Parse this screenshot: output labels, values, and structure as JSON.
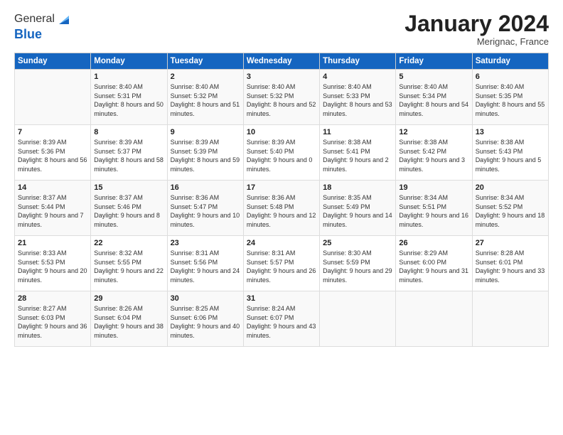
{
  "logo": {
    "general": "General",
    "blue": "Blue"
  },
  "title": "January 2024",
  "subtitle": "Merignac, France",
  "days": [
    "Sunday",
    "Monday",
    "Tuesday",
    "Wednesday",
    "Thursday",
    "Friday",
    "Saturday"
  ],
  "weeks": [
    [
      {
        "day": "",
        "sunrise": "",
        "sunset": "",
        "daylight": ""
      },
      {
        "day": "1",
        "sunrise": "Sunrise: 8:40 AM",
        "sunset": "Sunset: 5:31 PM",
        "daylight": "Daylight: 8 hours and 50 minutes."
      },
      {
        "day": "2",
        "sunrise": "Sunrise: 8:40 AM",
        "sunset": "Sunset: 5:32 PM",
        "daylight": "Daylight: 8 hours and 51 minutes."
      },
      {
        "day": "3",
        "sunrise": "Sunrise: 8:40 AM",
        "sunset": "Sunset: 5:32 PM",
        "daylight": "Daylight: 8 hours and 52 minutes."
      },
      {
        "day": "4",
        "sunrise": "Sunrise: 8:40 AM",
        "sunset": "Sunset: 5:33 PM",
        "daylight": "Daylight: 8 hours and 53 minutes."
      },
      {
        "day": "5",
        "sunrise": "Sunrise: 8:40 AM",
        "sunset": "Sunset: 5:34 PM",
        "daylight": "Daylight: 8 hours and 54 minutes."
      },
      {
        "day": "6",
        "sunrise": "Sunrise: 8:40 AM",
        "sunset": "Sunset: 5:35 PM",
        "daylight": "Daylight: 8 hours and 55 minutes."
      }
    ],
    [
      {
        "day": "7",
        "sunrise": "Sunrise: 8:39 AM",
        "sunset": "Sunset: 5:36 PM",
        "daylight": "Daylight: 8 hours and 56 minutes."
      },
      {
        "day": "8",
        "sunrise": "Sunrise: 8:39 AM",
        "sunset": "Sunset: 5:37 PM",
        "daylight": "Daylight: 8 hours and 58 minutes."
      },
      {
        "day": "9",
        "sunrise": "Sunrise: 8:39 AM",
        "sunset": "Sunset: 5:39 PM",
        "daylight": "Daylight: 8 hours and 59 minutes."
      },
      {
        "day": "10",
        "sunrise": "Sunrise: 8:39 AM",
        "sunset": "Sunset: 5:40 PM",
        "daylight": "Daylight: 9 hours and 0 minutes."
      },
      {
        "day": "11",
        "sunrise": "Sunrise: 8:38 AM",
        "sunset": "Sunset: 5:41 PM",
        "daylight": "Daylight: 9 hours and 2 minutes."
      },
      {
        "day": "12",
        "sunrise": "Sunrise: 8:38 AM",
        "sunset": "Sunset: 5:42 PM",
        "daylight": "Daylight: 9 hours and 3 minutes."
      },
      {
        "day": "13",
        "sunrise": "Sunrise: 8:38 AM",
        "sunset": "Sunset: 5:43 PM",
        "daylight": "Daylight: 9 hours and 5 minutes."
      }
    ],
    [
      {
        "day": "14",
        "sunrise": "Sunrise: 8:37 AM",
        "sunset": "Sunset: 5:44 PM",
        "daylight": "Daylight: 9 hours and 7 minutes."
      },
      {
        "day": "15",
        "sunrise": "Sunrise: 8:37 AM",
        "sunset": "Sunset: 5:46 PM",
        "daylight": "Daylight: 9 hours and 8 minutes."
      },
      {
        "day": "16",
        "sunrise": "Sunrise: 8:36 AM",
        "sunset": "Sunset: 5:47 PM",
        "daylight": "Daylight: 9 hours and 10 minutes."
      },
      {
        "day": "17",
        "sunrise": "Sunrise: 8:36 AM",
        "sunset": "Sunset: 5:48 PM",
        "daylight": "Daylight: 9 hours and 12 minutes."
      },
      {
        "day": "18",
        "sunrise": "Sunrise: 8:35 AM",
        "sunset": "Sunset: 5:49 PM",
        "daylight": "Daylight: 9 hours and 14 minutes."
      },
      {
        "day": "19",
        "sunrise": "Sunrise: 8:34 AM",
        "sunset": "Sunset: 5:51 PM",
        "daylight": "Daylight: 9 hours and 16 minutes."
      },
      {
        "day": "20",
        "sunrise": "Sunrise: 8:34 AM",
        "sunset": "Sunset: 5:52 PM",
        "daylight": "Daylight: 9 hours and 18 minutes."
      }
    ],
    [
      {
        "day": "21",
        "sunrise": "Sunrise: 8:33 AM",
        "sunset": "Sunset: 5:53 PM",
        "daylight": "Daylight: 9 hours and 20 minutes."
      },
      {
        "day": "22",
        "sunrise": "Sunrise: 8:32 AM",
        "sunset": "Sunset: 5:55 PM",
        "daylight": "Daylight: 9 hours and 22 minutes."
      },
      {
        "day": "23",
        "sunrise": "Sunrise: 8:31 AM",
        "sunset": "Sunset: 5:56 PM",
        "daylight": "Daylight: 9 hours and 24 minutes."
      },
      {
        "day": "24",
        "sunrise": "Sunrise: 8:31 AM",
        "sunset": "Sunset: 5:57 PM",
        "daylight": "Daylight: 9 hours and 26 minutes."
      },
      {
        "day": "25",
        "sunrise": "Sunrise: 8:30 AM",
        "sunset": "Sunset: 5:59 PM",
        "daylight": "Daylight: 9 hours and 29 minutes."
      },
      {
        "day": "26",
        "sunrise": "Sunrise: 8:29 AM",
        "sunset": "Sunset: 6:00 PM",
        "daylight": "Daylight: 9 hours and 31 minutes."
      },
      {
        "day": "27",
        "sunrise": "Sunrise: 8:28 AM",
        "sunset": "Sunset: 6:01 PM",
        "daylight": "Daylight: 9 hours and 33 minutes."
      }
    ],
    [
      {
        "day": "28",
        "sunrise": "Sunrise: 8:27 AM",
        "sunset": "Sunset: 6:03 PM",
        "daylight": "Daylight: 9 hours and 36 minutes."
      },
      {
        "day": "29",
        "sunrise": "Sunrise: 8:26 AM",
        "sunset": "Sunset: 6:04 PM",
        "daylight": "Daylight: 9 hours and 38 minutes."
      },
      {
        "day": "30",
        "sunrise": "Sunrise: 8:25 AM",
        "sunset": "Sunset: 6:06 PM",
        "daylight": "Daylight: 9 hours and 40 minutes."
      },
      {
        "day": "31",
        "sunrise": "Sunrise: 8:24 AM",
        "sunset": "Sunset: 6:07 PM",
        "daylight": "Daylight: 9 hours and 43 minutes."
      },
      {
        "day": "",
        "sunrise": "",
        "sunset": "",
        "daylight": ""
      },
      {
        "day": "",
        "sunrise": "",
        "sunset": "",
        "daylight": ""
      },
      {
        "day": "",
        "sunrise": "",
        "sunset": "",
        "daylight": ""
      }
    ]
  ]
}
